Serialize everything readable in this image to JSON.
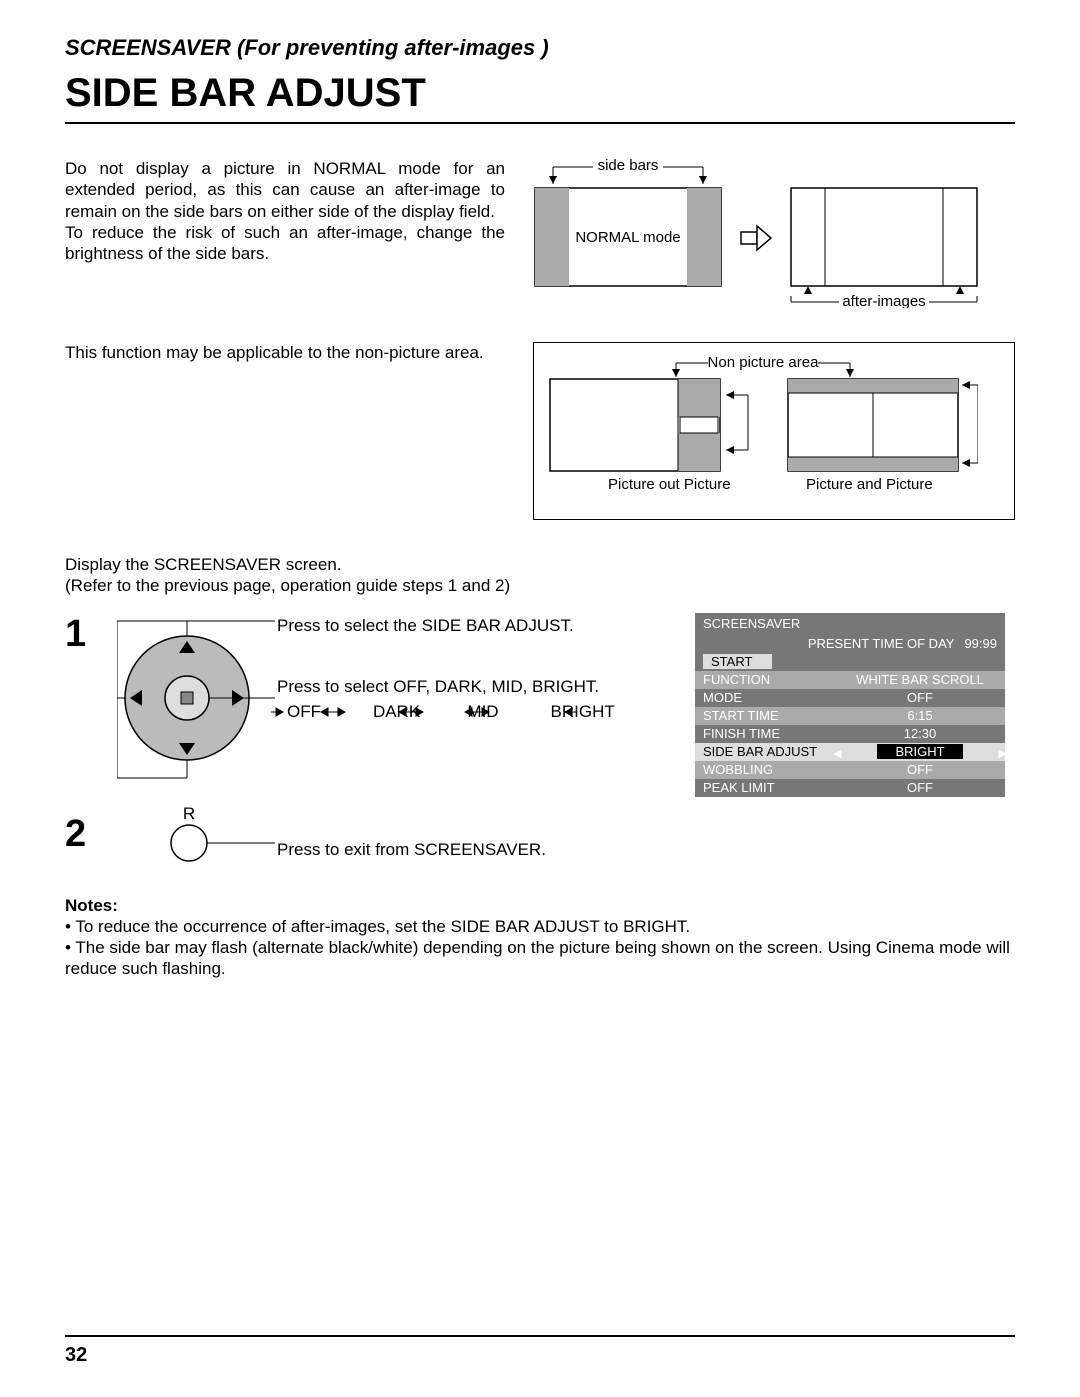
{
  "header_small": "SCREENSAVER (For preventing after-images )",
  "title": "SIDE BAR ADJUST",
  "intro": {
    "p1": "Do not display a picture in NORMAL mode for an extended period, as this can cause an after-image to remain on the side bars on either side of the display field.",
    "p2": "To reduce the risk of such an after-image, change the brightness of the side bars."
  },
  "diagram1": {
    "side_bars": "side bars",
    "normal_mode": "NORMAL mode",
    "after_images": "after-images"
  },
  "applicable_text": "This function may be applicable to the non-picture area.",
  "diagram2": {
    "non_picture_area": "Non picture area",
    "picture_out": "Picture out Picture",
    "picture_and": "Picture and Picture"
  },
  "display_instr": {
    "l1": "Display the SCREENSAVER screen.",
    "l2": "(Refer to the previous page, operation guide steps 1 and 2)"
  },
  "steps": {
    "one": "1",
    "two": "2",
    "press_select_side": "Press to select the SIDE BAR ADJUST.",
    "press_select_off": "Press to select OFF, DARK, MID, BRIGHT.",
    "cycle": "OFF           DARK          MID           BRIGHT",
    "r_label": "R",
    "press_exit": "Press to exit from SCREENSAVER."
  },
  "osd": {
    "title": "SCREENSAVER",
    "present_time_label": "PRESENT  TIME OF DAY",
    "present_time_val": "99:99",
    "start": "START",
    "rows": [
      {
        "label": "FUNCTION",
        "val": "WHITE BAR SCROLL",
        "light": true
      },
      {
        "label": "MODE",
        "val": "OFF",
        "light": false
      },
      {
        "label": "START TIME",
        "val": "6:15",
        "light": true
      },
      {
        "label": "FINISH TIME",
        "val": "12:30",
        "light": false
      }
    ],
    "side_bar_label": "SIDE BAR ADJUST",
    "side_bar_val": "BRIGHT",
    "wobbling": {
      "label": "WOBBLING",
      "val": "OFF"
    },
    "peak": {
      "label": "PEAK LIMIT",
      "val": "OFF"
    }
  },
  "notes": {
    "title": "Notes:",
    "n1": "To reduce the occurrence of after-images, set the SIDE BAR ADJUST to BRIGHT.",
    "n2": "The side bar may flash (alternate black/white) depending on the picture being shown on the screen. Using Cinema mode will reduce such flashing."
  },
  "page_number": "32"
}
